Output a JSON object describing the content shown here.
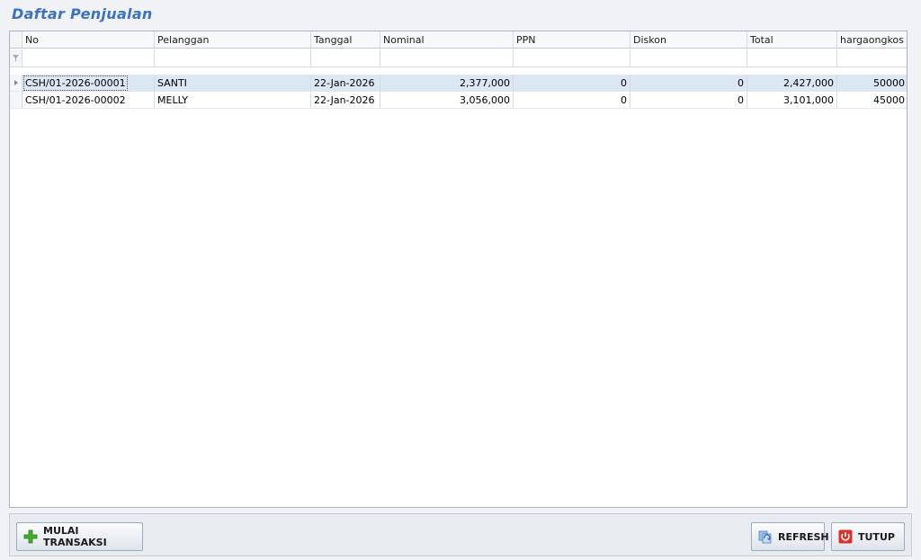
{
  "page": {
    "title": "Daftar Penjualan"
  },
  "table": {
    "columns": [
      "No",
      "Pelanggan",
      "Tanggal",
      "Nominal",
      "PPN",
      "Diskon",
      "Total",
      "hargaongkos"
    ],
    "rows": [
      {
        "no": "CSH/01-2026-00001",
        "pelanggan": "SANTI",
        "tanggal": "22-Jan-2026",
        "nominal": "2,377,000",
        "ppn": "0",
        "diskon": "0",
        "total": "2,427,000",
        "hargaongkos": "50000"
      },
      {
        "no": "CSH/01-2026-00002",
        "pelanggan": "MELLY",
        "tanggal": "22-Jan-2026",
        "nominal": "3,056,000",
        "ppn": "0",
        "diskon": "0",
        "total": "3,101,000",
        "hargaongkos": "45000"
      }
    ]
  },
  "buttons": {
    "mulai": "MULAI TRANSAKSI",
    "refresh": "REFRESH",
    "tutup": "TUTUP"
  },
  "icons": {
    "mulai": "plus-icon",
    "refresh": "refresh-icon",
    "tutup": "power-icon",
    "filter": "filter-icon",
    "row_indicator": "row-indicator-icon"
  },
  "colors": {
    "title": "#3b72c6",
    "selected_row": "#dde7f3",
    "plus": "#3fae2a",
    "power": "#d9342b"
  }
}
